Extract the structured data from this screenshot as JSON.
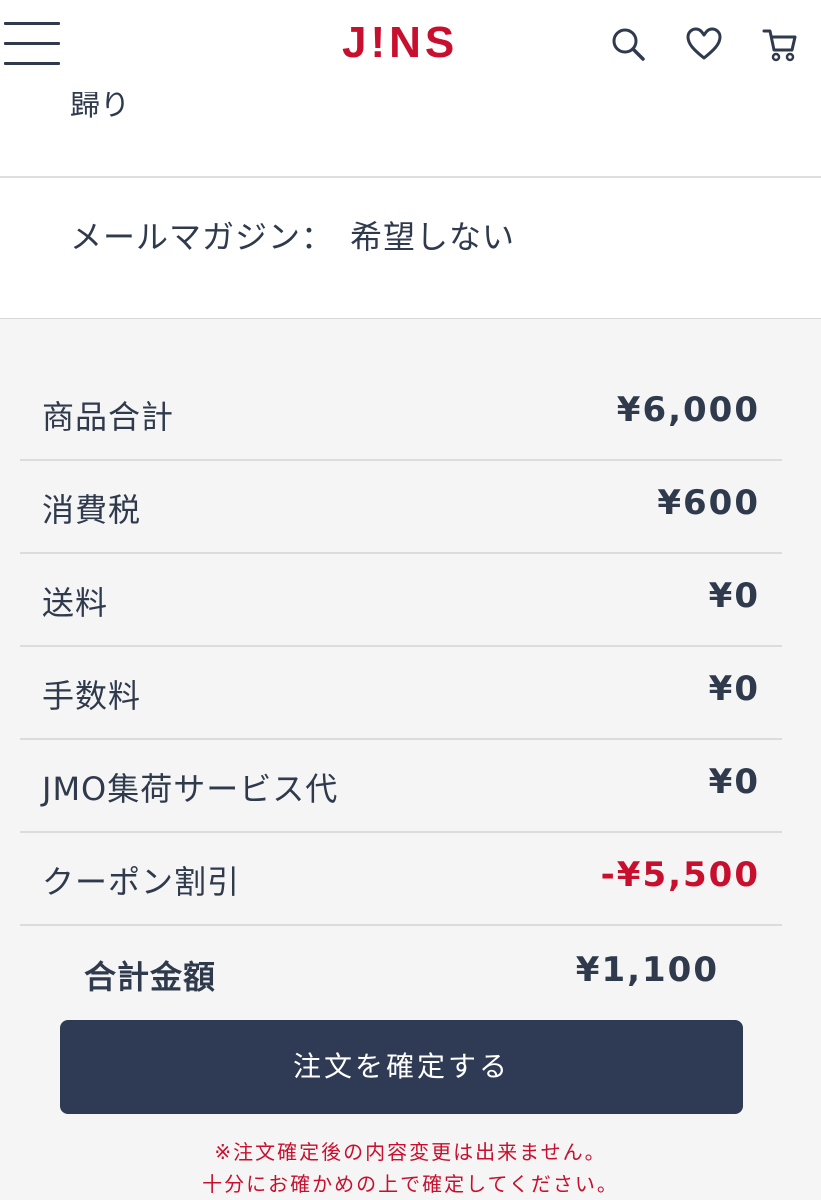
{
  "header": {
    "logo": "J!NS",
    "icons": [
      "menu-icon",
      "search-icon",
      "heart-icon",
      "cart-icon"
    ]
  },
  "partial_text": "歸り",
  "newsletter": {
    "label": "メールマガジン：",
    "value": "希望しない"
  },
  "summary": {
    "rows": [
      {
        "label": "商品合計",
        "value": "¥6,000"
      },
      {
        "label": "消費税",
        "value": "¥600"
      },
      {
        "label": "送料",
        "value": "¥0"
      },
      {
        "label": "手数料",
        "value": "¥0"
      },
      {
        "label": "JMO集荷サービス代",
        "value": "¥0"
      },
      {
        "label": "クーポン割引",
        "value": "-¥5,500"
      }
    ],
    "total_label": "合計金額",
    "total_value": "¥1,100"
  },
  "confirm_button": "注文を確定する",
  "notes": [
    "※注文確定後の内容変更は出来ません。",
    "十分にお確かめの上で確定してください。"
  ],
  "colors": {
    "brand": "#c8102e",
    "text": "#2f3a4d",
    "button": "#2f3a55",
    "background": "#f5f5f5"
  }
}
